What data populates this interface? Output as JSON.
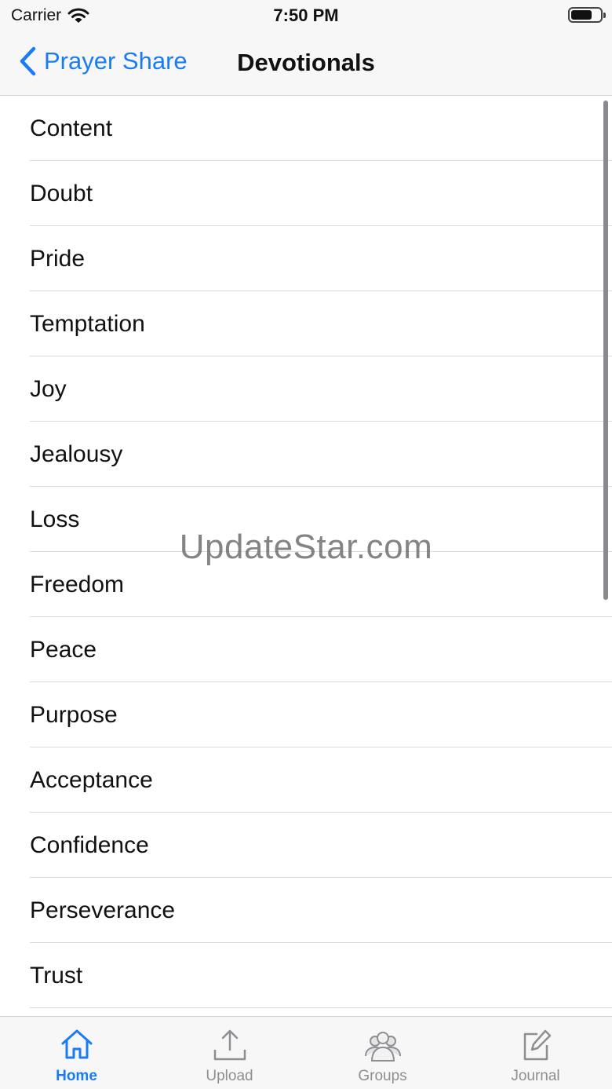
{
  "status_bar": {
    "carrier": "Carrier",
    "time": "7:50 PM",
    "wifi_icon": "wifi-icon",
    "battery_icon": "battery-icon"
  },
  "nav": {
    "back_label": "Prayer Share",
    "back_icon": "chevron-left-icon",
    "title": "Devotionals"
  },
  "devotionals": [
    "Content",
    "Doubt",
    "Pride",
    "Temptation",
    "Joy",
    "Jealousy",
    "Loss",
    "Freedom",
    "Peace",
    "Purpose",
    "Acceptance",
    "Confidence",
    "Perseverance",
    "Trust"
  ],
  "watermark": "UpdateStar.com",
  "tabs": [
    {
      "label": "Home",
      "icon": "home-icon",
      "active": true
    },
    {
      "label": "Upload",
      "icon": "upload-icon",
      "active": false
    },
    {
      "label": "Groups",
      "icon": "groups-icon",
      "active": false
    },
    {
      "label": "Journal",
      "icon": "journal-icon",
      "active": false
    }
  ],
  "colors": {
    "accent": "#1a7cf5",
    "inactive": "#8e8e93",
    "bar_background": "#f7f7f7",
    "separator": "#dadadc"
  }
}
